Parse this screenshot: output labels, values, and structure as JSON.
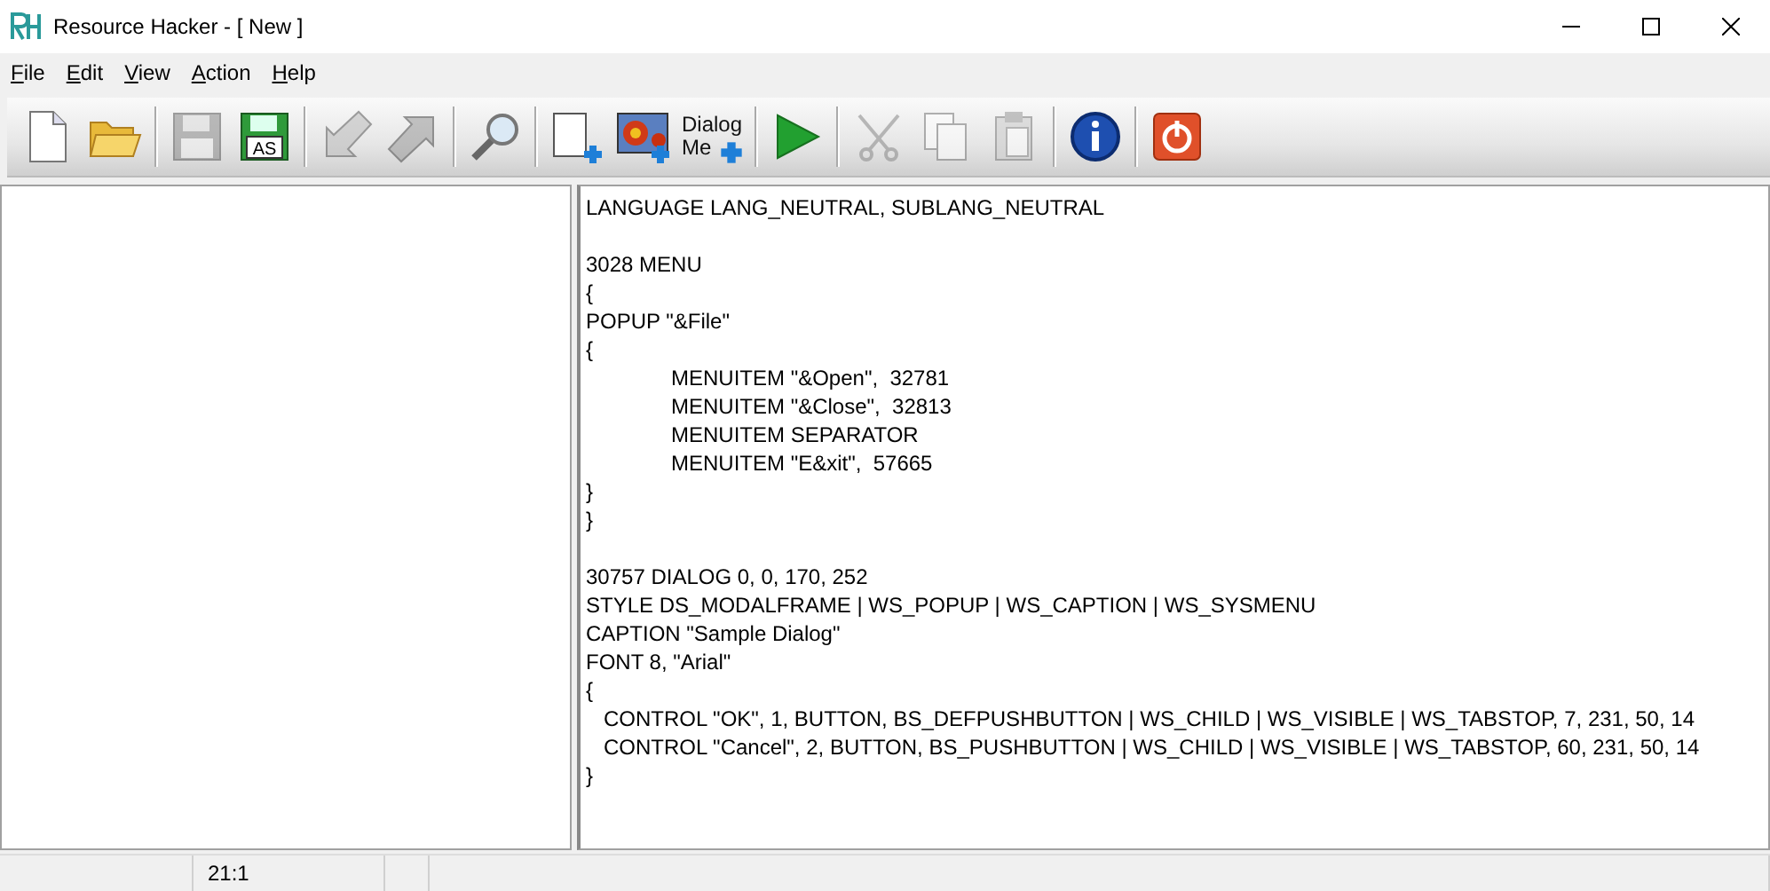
{
  "window": {
    "title": "Resource Hacker - [ New ]"
  },
  "menu": [
    {
      "label": "File"
    },
    {
      "label": "Edit"
    },
    {
      "label": "View"
    },
    {
      "label": "Action"
    },
    {
      "label": "Help"
    }
  ],
  "toolbar": [
    {
      "kind": "new",
      "disabled": false
    },
    {
      "kind": "open",
      "disabled": false
    },
    {
      "kind": "sep"
    },
    {
      "kind": "save",
      "disabled": true
    },
    {
      "kind": "saveas",
      "disabled": false,
      "label": "AS"
    },
    {
      "kind": "sep"
    },
    {
      "kind": "back",
      "disabled": true
    },
    {
      "kind": "forward",
      "disabled": true
    },
    {
      "kind": "sep"
    },
    {
      "kind": "search",
      "disabled": false
    },
    {
      "kind": "sep"
    },
    {
      "kind": "addpage",
      "disabled": false
    },
    {
      "kind": "addimage",
      "disabled": false
    },
    {
      "kind": "dialog",
      "disabled": false,
      "label": "Dialog Me"
    },
    {
      "kind": "sep"
    },
    {
      "kind": "run",
      "disabled": false
    },
    {
      "kind": "sep"
    },
    {
      "kind": "cut",
      "disabled": true
    },
    {
      "kind": "copy",
      "disabled": true
    },
    {
      "kind": "paste",
      "disabled": true
    },
    {
      "kind": "sep"
    },
    {
      "kind": "info",
      "disabled": false
    },
    {
      "kind": "sep"
    },
    {
      "kind": "power",
      "disabled": false
    }
  ],
  "editor": {
    "blocks": [
      [
        "LANGUAGE LANG_NEUTRAL, SUBLANG_NEUTRAL"
      ],
      [
        "3028 MENU",
        "{",
        "POPUP \"&File\"",
        "{",
        "\tMENUITEM \"&Open\",  32781",
        "\tMENUITEM \"&Close\",  32813",
        "\tMENUITEM SEPARATOR",
        "\tMENUITEM \"E&xit\",  57665",
        "}",
        "}"
      ],
      [
        "30757 DIALOG 0, 0, 170, 252",
        "STYLE DS_MODALFRAME | WS_POPUP | WS_CAPTION | WS_SYSMENU",
        "CAPTION \"Sample Dialog\"",
        "FONT 8, \"Arial\"",
        "{",
        "   CONTROL \"OK\", 1, BUTTON, BS_DEFPUSHBUTTON | WS_CHILD | WS_VISIBLE | WS_TABSTOP, 7, 231, 50, 14",
        "   CONTROL \"Cancel\", 2, BUTTON, BS_PUSHBUTTON | WS_CHILD | WS_VISIBLE | WS_TABSTOP, 60, 231, 50, 14",
        "}"
      ]
    ]
  },
  "status_bar": {
    "position": "21:1"
  }
}
